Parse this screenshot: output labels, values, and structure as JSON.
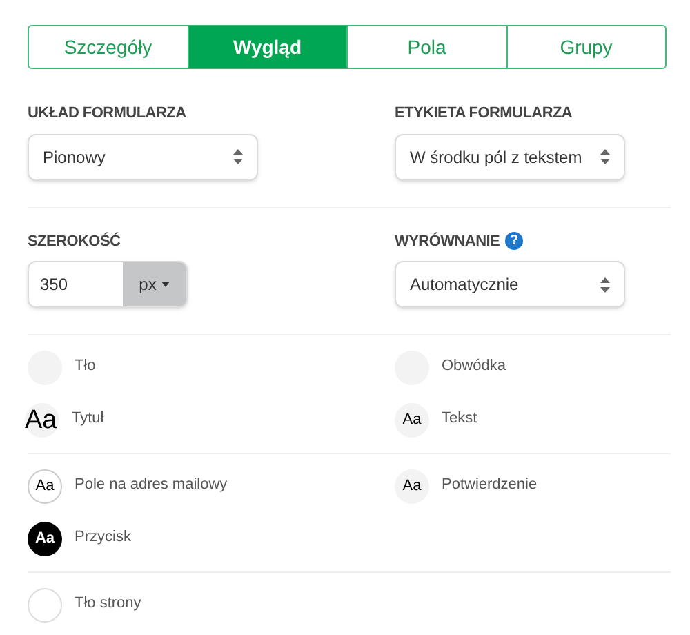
{
  "tabs": [
    {
      "label": "Szczegóły",
      "selected": false
    },
    {
      "label": "Wygląd",
      "selected": true
    },
    {
      "label": "Pola",
      "selected": false
    },
    {
      "label": "Grupy",
      "selected": false
    }
  ],
  "layout": {
    "label": "UKŁAD FORMULARZA",
    "value": "Pionowy"
  },
  "form_label": {
    "label": "ETYKIETA FORMULARZA",
    "value": "W środku pól z tekstem"
  },
  "width": {
    "label": "SZEROKOŚĆ",
    "value": "350",
    "unit": "px"
  },
  "alignment": {
    "label": "WYRÓWNANIE",
    "help": "?",
    "value": "Automatycznie"
  },
  "groups": [
    {
      "items": [
        {
          "kind": "color",
          "color": "#f3f3f3",
          "label": "Tło"
        },
        {
          "kind": "color",
          "color": "#f3f3f3",
          "label": "Obwódka"
        },
        {
          "kind": "font-large",
          "sample": "Aa",
          "label": "Tytuł"
        },
        {
          "kind": "font-soft",
          "sample": "Aa",
          "label": "Tekst"
        }
      ]
    },
    {
      "items": [
        {
          "kind": "font-outline",
          "sample": "Aa",
          "label": "Pole na adres mailowy"
        },
        {
          "kind": "font-soft",
          "sample": "Aa",
          "label": "Potwierdzenie"
        },
        {
          "kind": "font-dark",
          "sample": "Aa",
          "label": "Przycisk"
        }
      ]
    },
    {
      "items": [
        {
          "kind": "color",
          "color": "#ffffff",
          "label": "Tło strony"
        }
      ]
    }
  ]
}
